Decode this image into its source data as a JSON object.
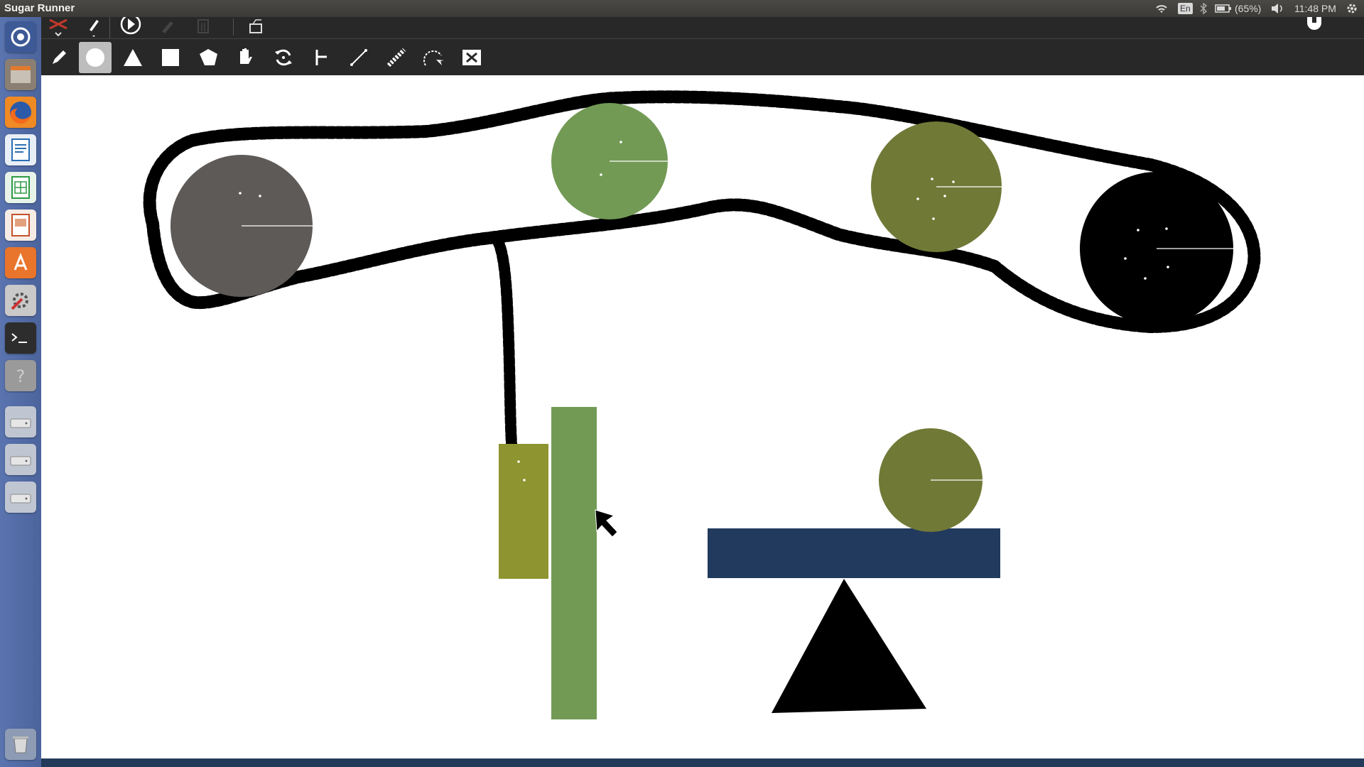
{
  "app": {
    "title": "Sugar Runner"
  },
  "tray": {
    "keyboard": "En",
    "battery": "(65%)",
    "time": "11:48 PM"
  },
  "launcher": {
    "items": [
      "dash-icon",
      "files-icon",
      "firefox-icon",
      "writer-icon",
      "calc-icon",
      "impress-icon",
      "software-center-icon",
      "system-settings-icon",
      "terminal-icon",
      "help-icon",
      "drive-icon",
      "drive-icon",
      "drive-icon",
      "trash-icon"
    ]
  },
  "toolbar": {
    "top_items": [
      "activity-icon",
      "edit-icon",
      "run-icon",
      "pen-icon",
      "delete-icon",
      "export-icon",
      "stop-icon"
    ],
    "tools": [
      "pencil",
      "circle",
      "triangle",
      "box",
      "polygon",
      "grab",
      "motor",
      "pin",
      "joint",
      "chain",
      "magic-pen",
      "destroy"
    ],
    "active_tool": "circle"
  },
  "colors": {
    "panel": "#3b3a36",
    "launcher": "#5a74b0",
    "toolbar": "#282828",
    "gray_circle": "#5e5a58",
    "green_circle": "#729a55",
    "olive_circle": "#717937",
    "black_circle": "#000000",
    "olive_box": "#8e942f",
    "green_bar": "#729a55",
    "plank": "#213a5e",
    "chain": "#000000"
  }
}
